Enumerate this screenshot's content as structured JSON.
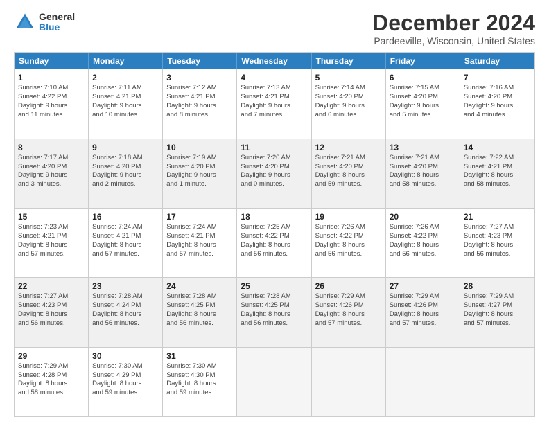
{
  "logo": {
    "general": "General",
    "blue": "Blue"
  },
  "title": "December 2024",
  "location": "Pardeeville, Wisconsin, United States",
  "days_of_week": [
    "Sunday",
    "Monday",
    "Tuesday",
    "Wednesday",
    "Thursday",
    "Friday",
    "Saturday"
  ],
  "weeks": [
    [
      {
        "day": "1",
        "info": "Sunrise: 7:10 AM\nSunset: 4:22 PM\nDaylight: 9 hours\nand 11 minutes."
      },
      {
        "day": "2",
        "info": "Sunrise: 7:11 AM\nSunset: 4:21 PM\nDaylight: 9 hours\nand 10 minutes."
      },
      {
        "day": "3",
        "info": "Sunrise: 7:12 AM\nSunset: 4:21 PM\nDaylight: 9 hours\nand 8 minutes."
      },
      {
        "day": "4",
        "info": "Sunrise: 7:13 AM\nSunset: 4:21 PM\nDaylight: 9 hours\nand 7 minutes."
      },
      {
        "day": "5",
        "info": "Sunrise: 7:14 AM\nSunset: 4:20 PM\nDaylight: 9 hours\nand 6 minutes."
      },
      {
        "day": "6",
        "info": "Sunrise: 7:15 AM\nSunset: 4:20 PM\nDaylight: 9 hours\nand 5 minutes."
      },
      {
        "day": "7",
        "info": "Sunrise: 7:16 AM\nSunset: 4:20 PM\nDaylight: 9 hours\nand 4 minutes."
      }
    ],
    [
      {
        "day": "8",
        "info": "Sunrise: 7:17 AM\nSunset: 4:20 PM\nDaylight: 9 hours\nand 3 minutes."
      },
      {
        "day": "9",
        "info": "Sunrise: 7:18 AM\nSunset: 4:20 PM\nDaylight: 9 hours\nand 2 minutes."
      },
      {
        "day": "10",
        "info": "Sunrise: 7:19 AM\nSunset: 4:20 PM\nDaylight: 9 hours\nand 1 minute."
      },
      {
        "day": "11",
        "info": "Sunrise: 7:20 AM\nSunset: 4:20 PM\nDaylight: 9 hours\nand 0 minutes."
      },
      {
        "day": "12",
        "info": "Sunrise: 7:21 AM\nSunset: 4:20 PM\nDaylight: 8 hours\nand 59 minutes."
      },
      {
        "day": "13",
        "info": "Sunrise: 7:21 AM\nSunset: 4:20 PM\nDaylight: 8 hours\nand 58 minutes."
      },
      {
        "day": "14",
        "info": "Sunrise: 7:22 AM\nSunset: 4:21 PM\nDaylight: 8 hours\nand 58 minutes."
      }
    ],
    [
      {
        "day": "15",
        "info": "Sunrise: 7:23 AM\nSunset: 4:21 PM\nDaylight: 8 hours\nand 57 minutes."
      },
      {
        "day": "16",
        "info": "Sunrise: 7:24 AM\nSunset: 4:21 PM\nDaylight: 8 hours\nand 57 minutes."
      },
      {
        "day": "17",
        "info": "Sunrise: 7:24 AM\nSunset: 4:21 PM\nDaylight: 8 hours\nand 57 minutes."
      },
      {
        "day": "18",
        "info": "Sunrise: 7:25 AM\nSunset: 4:22 PM\nDaylight: 8 hours\nand 56 minutes."
      },
      {
        "day": "19",
        "info": "Sunrise: 7:26 AM\nSunset: 4:22 PM\nDaylight: 8 hours\nand 56 minutes."
      },
      {
        "day": "20",
        "info": "Sunrise: 7:26 AM\nSunset: 4:22 PM\nDaylight: 8 hours\nand 56 minutes."
      },
      {
        "day": "21",
        "info": "Sunrise: 7:27 AM\nSunset: 4:23 PM\nDaylight: 8 hours\nand 56 minutes."
      }
    ],
    [
      {
        "day": "22",
        "info": "Sunrise: 7:27 AM\nSunset: 4:23 PM\nDaylight: 8 hours\nand 56 minutes."
      },
      {
        "day": "23",
        "info": "Sunrise: 7:28 AM\nSunset: 4:24 PM\nDaylight: 8 hours\nand 56 minutes."
      },
      {
        "day": "24",
        "info": "Sunrise: 7:28 AM\nSunset: 4:25 PM\nDaylight: 8 hours\nand 56 minutes."
      },
      {
        "day": "25",
        "info": "Sunrise: 7:28 AM\nSunset: 4:25 PM\nDaylight: 8 hours\nand 56 minutes."
      },
      {
        "day": "26",
        "info": "Sunrise: 7:29 AM\nSunset: 4:26 PM\nDaylight: 8 hours\nand 57 minutes."
      },
      {
        "day": "27",
        "info": "Sunrise: 7:29 AM\nSunset: 4:26 PM\nDaylight: 8 hours\nand 57 minutes."
      },
      {
        "day": "28",
        "info": "Sunrise: 7:29 AM\nSunset: 4:27 PM\nDaylight: 8 hours\nand 57 minutes."
      }
    ],
    [
      {
        "day": "29",
        "info": "Sunrise: 7:29 AM\nSunset: 4:28 PM\nDaylight: 8 hours\nand 58 minutes."
      },
      {
        "day": "30",
        "info": "Sunrise: 7:30 AM\nSunset: 4:29 PM\nDaylight: 8 hours\nand 59 minutes."
      },
      {
        "day": "31",
        "info": "Sunrise: 7:30 AM\nSunset: 4:30 PM\nDaylight: 8 hours\nand 59 minutes."
      },
      {
        "day": "",
        "info": ""
      },
      {
        "day": "",
        "info": ""
      },
      {
        "day": "",
        "info": ""
      },
      {
        "day": "",
        "info": ""
      }
    ]
  ]
}
